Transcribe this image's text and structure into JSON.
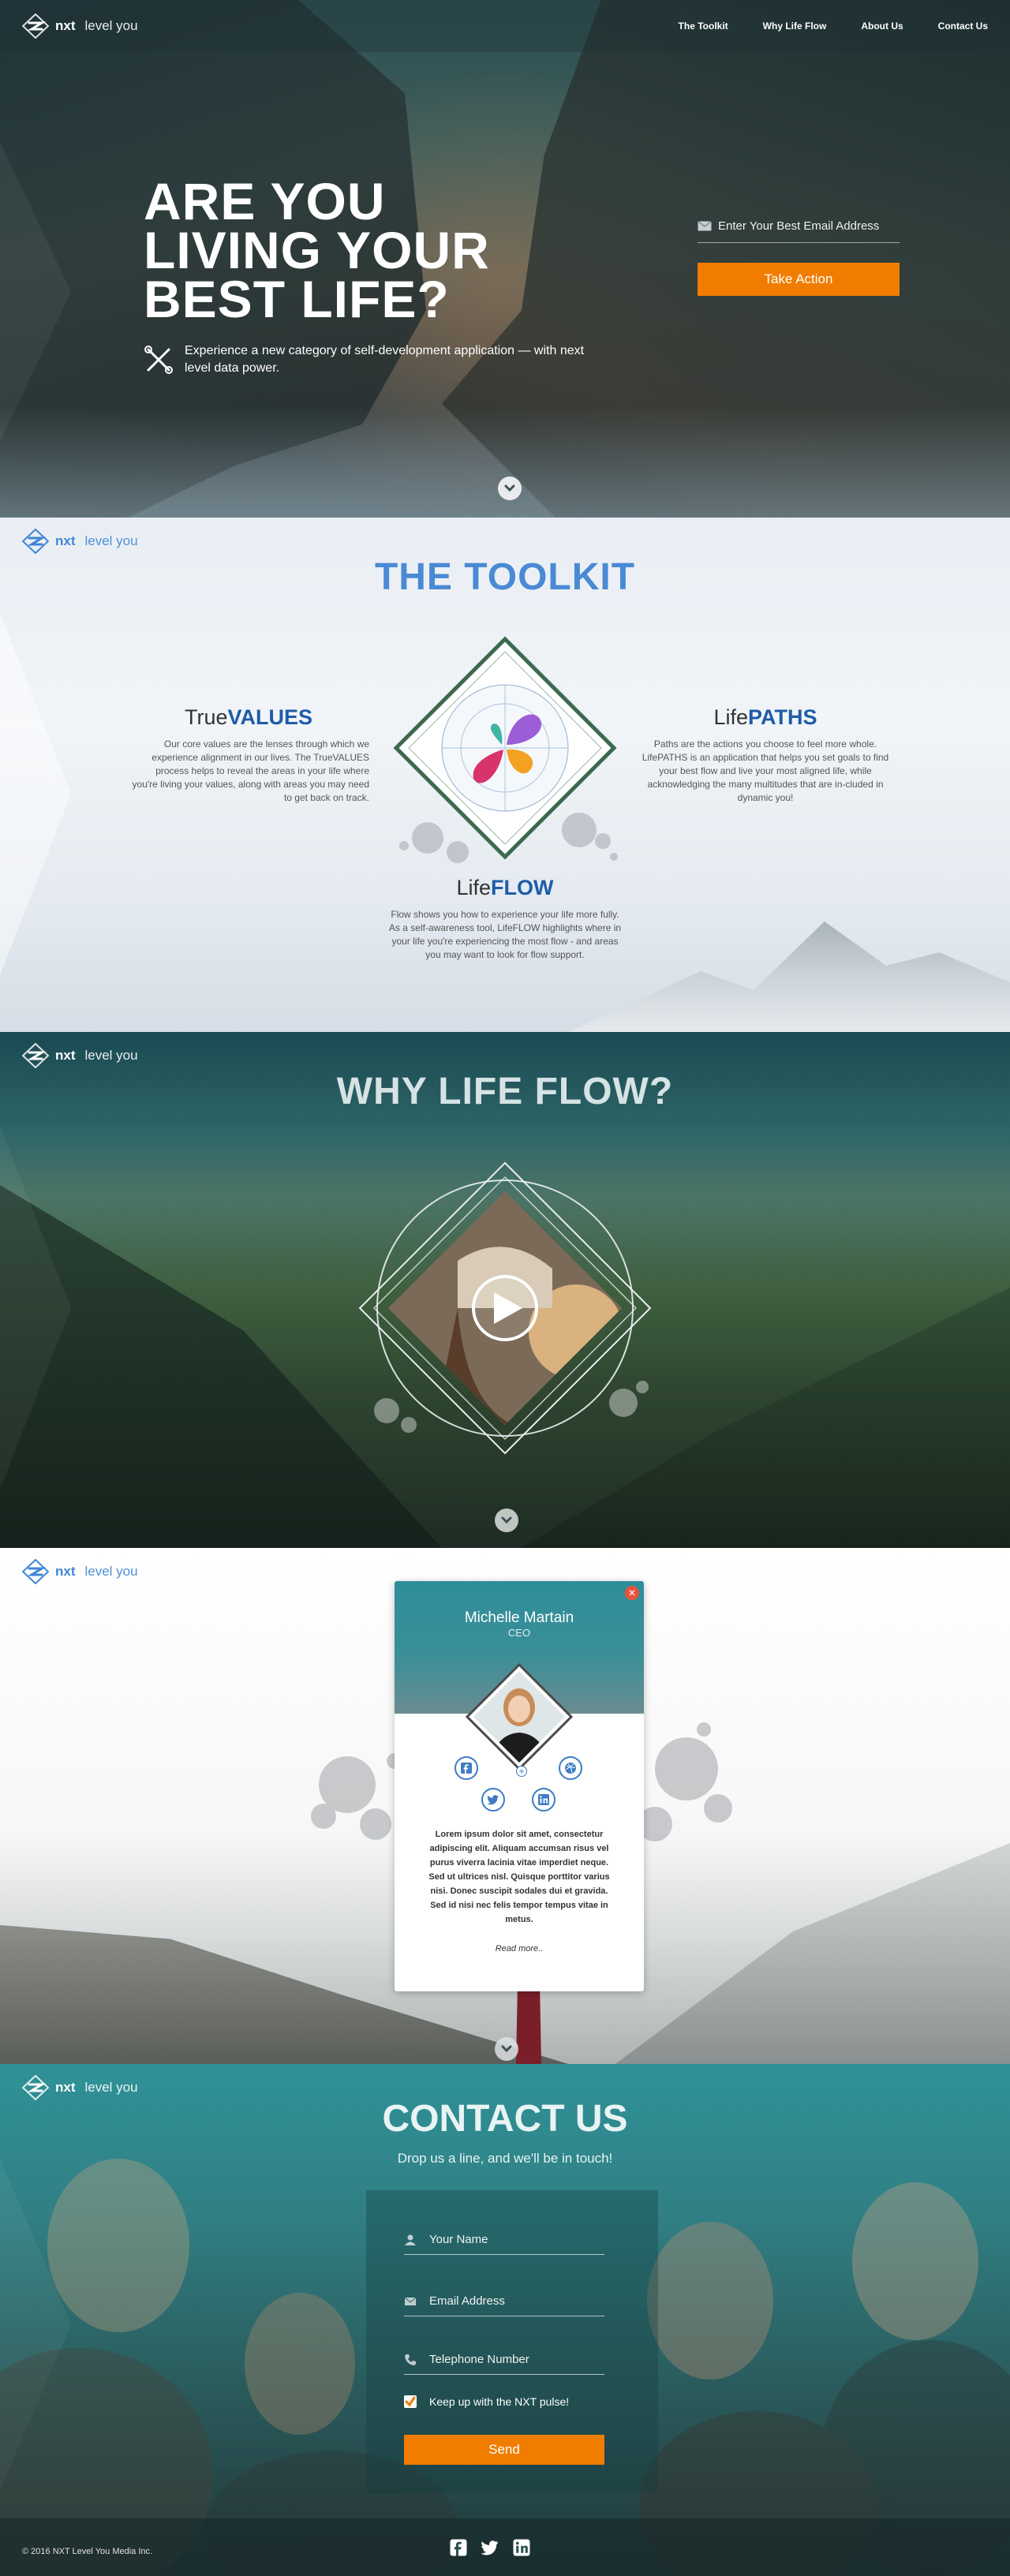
{
  "brand": {
    "nxt": "nxt",
    "rest": "level you"
  },
  "nav": {
    "items": [
      "The Toolkit",
      "Why Life Flow",
      "About Us",
      "Contact Us"
    ]
  },
  "hero": {
    "title_lines": [
      "ARE YOU",
      "LIVING YOUR",
      "BEST LIFE?"
    ],
    "subtitle": "Experience a new category of self-development application — with next level data power.",
    "email_placeholder": "Enter Your Best Email Address",
    "cta": "Take Action"
  },
  "toolkit": {
    "title": "THE TOOLKIT",
    "values": {
      "pre": "True",
      "bold": "VALUES",
      "text": "Our core values are the lenses through which we experience alignment in our lives. The TrueVALUES process helps to reveal the areas in your life where you're living your values, along with areas you may need to get back on track."
    },
    "paths": {
      "pre": "Life",
      "bold": "PATHS",
      "text": "Paths are the actions you choose to feel more whole. LifePATHS is an application that helps you set goals to find your best flow and live your most aligned life, while acknowledging the many multitudes that are in-cluded in dynamic you!"
    },
    "flow": {
      "pre": "Life",
      "bold": "FLOW",
      "text": "Flow shows you how to experience your life more fully. As a self-awareness tool, LifeFLOW highlights where in your life you're experiencing the most flow - and areas you may want to look for flow support."
    }
  },
  "why": {
    "title": "WHY LIFE FLOW?"
  },
  "team": {
    "name": "Michelle Martain",
    "role": "CEO",
    "bio": "Lorem ipsum dolor sit amet, consectetur adipiscing elit. Aliquam accumsan risus vel purus viverra lacinia vitae imperdiet neque. Sed ut ultrices nisl. Quisque porttitor varius nisi. Donec suscipit sodales dui et gravida. Sed id nisi nec felis tempor tempus vitae in metus.",
    "more": "Read more..",
    "plus": "+"
  },
  "contact": {
    "title": "CONTACT US",
    "subtitle": "Drop us a line, and we'll be in touch!",
    "name_placeholder": "Your Name",
    "email_placeholder": "Email Address",
    "phone_placeholder": "Telephone Number",
    "checkbox_label": "Keep up with the NXT pulse!",
    "send": "Send"
  },
  "footer": {
    "copyright": "© 2016 NXT Level You Media Inc."
  },
  "colors": {
    "accent": "#f07d00",
    "brand_blue": "#3f86d6",
    "title_blue": "#4a8ad4",
    "dark_blue": "#1e5ca8"
  },
  "icons": [
    "logo-mark-icon",
    "tools-icon",
    "envelope-icon",
    "chevron-down-icon",
    "play-icon",
    "close-icon",
    "facebook-icon",
    "twitter-icon",
    "linkedin-icon",
    "dribbble-icon",
    "user-icon",
    "phone-icon",
    "check-icon"
  ]
}
